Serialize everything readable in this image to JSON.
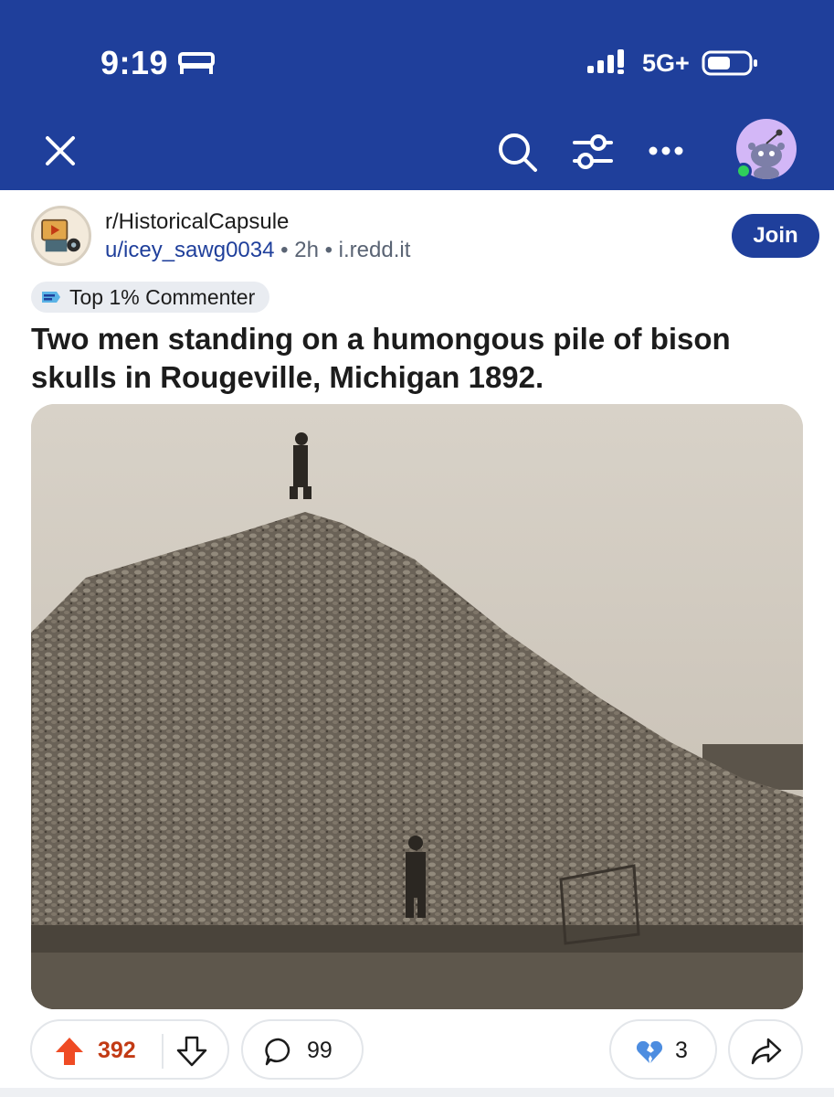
{
  "status_bar": {
    "time": "9:19",
    "network": "5G+",
    "icons": [
      "bed-icon",
      "signal-icon",
      "battery-icon"
    ]
  },
  "toolbar": {
    "icons": [
      "close-icon",
      "search-icon",
      "filter-icon",
      "more-icon",
      "avatar"
    ]
  },
  "post": {
    "subreddit": "r/HistoricalCapsule",
    "author": "u/icey_sawg0034",
    "separator": "•",
    "age": "2h",
    "domain": "i.redd.it",
    "join_label": "Join",
    "flair": "Top 1% Commenter",
    "title": "Two men standing on a humongous pile of bison skulls in Rougeville, Michigan 1892."
  },
  "actions": {
    "score": "392",
    "comments": "99",
    "awards": "3"
  },
  "colors": {
    "brand": "#1f3f9b",
    "upvote": "#ef4b24",
    "score": "#c23a14",
    "photo_sepia": "#cfc8bc"
  }
}
